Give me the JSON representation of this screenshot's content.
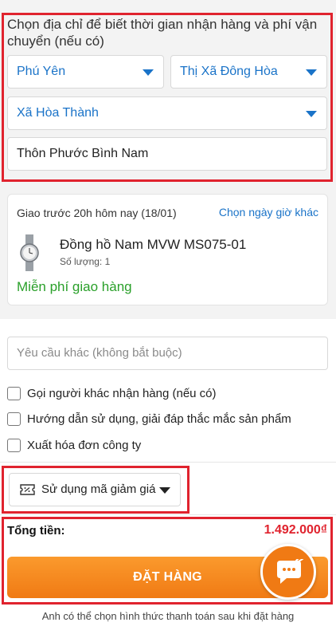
{
  "address": {
    "title": "Chọn địa chỉ để biết thời gian nhận hàng và phí vận chuyển (nếu có)",
    "province": "Phú Yên",
    "district": "Thị Xã Đông Hòa",
    "ward": "Xã Hòa Thành",
    "street": "Thôn Phước Bình Nam"
  },
  "delivery": {
    "time_text": "Giao trước 20h hôm nay (18/01)",
    "change_link": "Chọn ngày giờ khác",
    "product_name": "Đồng hồ Nam MVW MS075-01",
    "quantity_text": "Số lượng: 1",
    "shipping_text": "Miễn phí giao hàng"
  },
  "note": {
    "placeholder": "Yêu cầu khác (không bắt buộc)"
  },
  "options": [
    "Gọi người khác nhận hàng (nếu có)",
    "Hướng dẫn sử dụng, giải đáp thắc mắc sản phẩm",
    "Xuất hóa đơn công ty"
  ],
  "coupon": {
    "label": "Sử dụng mã giảm giá"
  },
  "summary": {
    "total_label": "Tổng tiền:",
    "total_value": "1.492.000₫",
    "order_button": "ĐẶT HÀNG",
    "footer_note": "Anh có thể chọn hình thức thanh toán sau khi đặt hàng"
  },
  "colors": {
    "accent_blue": "#1a73c8",
    "highlight_red": "#e0232e",
    "order_orange": "#f07a14",
    "free_ship_green": "#2aa02a"
  },
  "icons": {
    "dropdown": "caret-down-icon",
    "coupon": "ticket-icon",
    "chat": "chat-bubble-icon",
    "checkbox": "checkbox-icon"
  }
}
